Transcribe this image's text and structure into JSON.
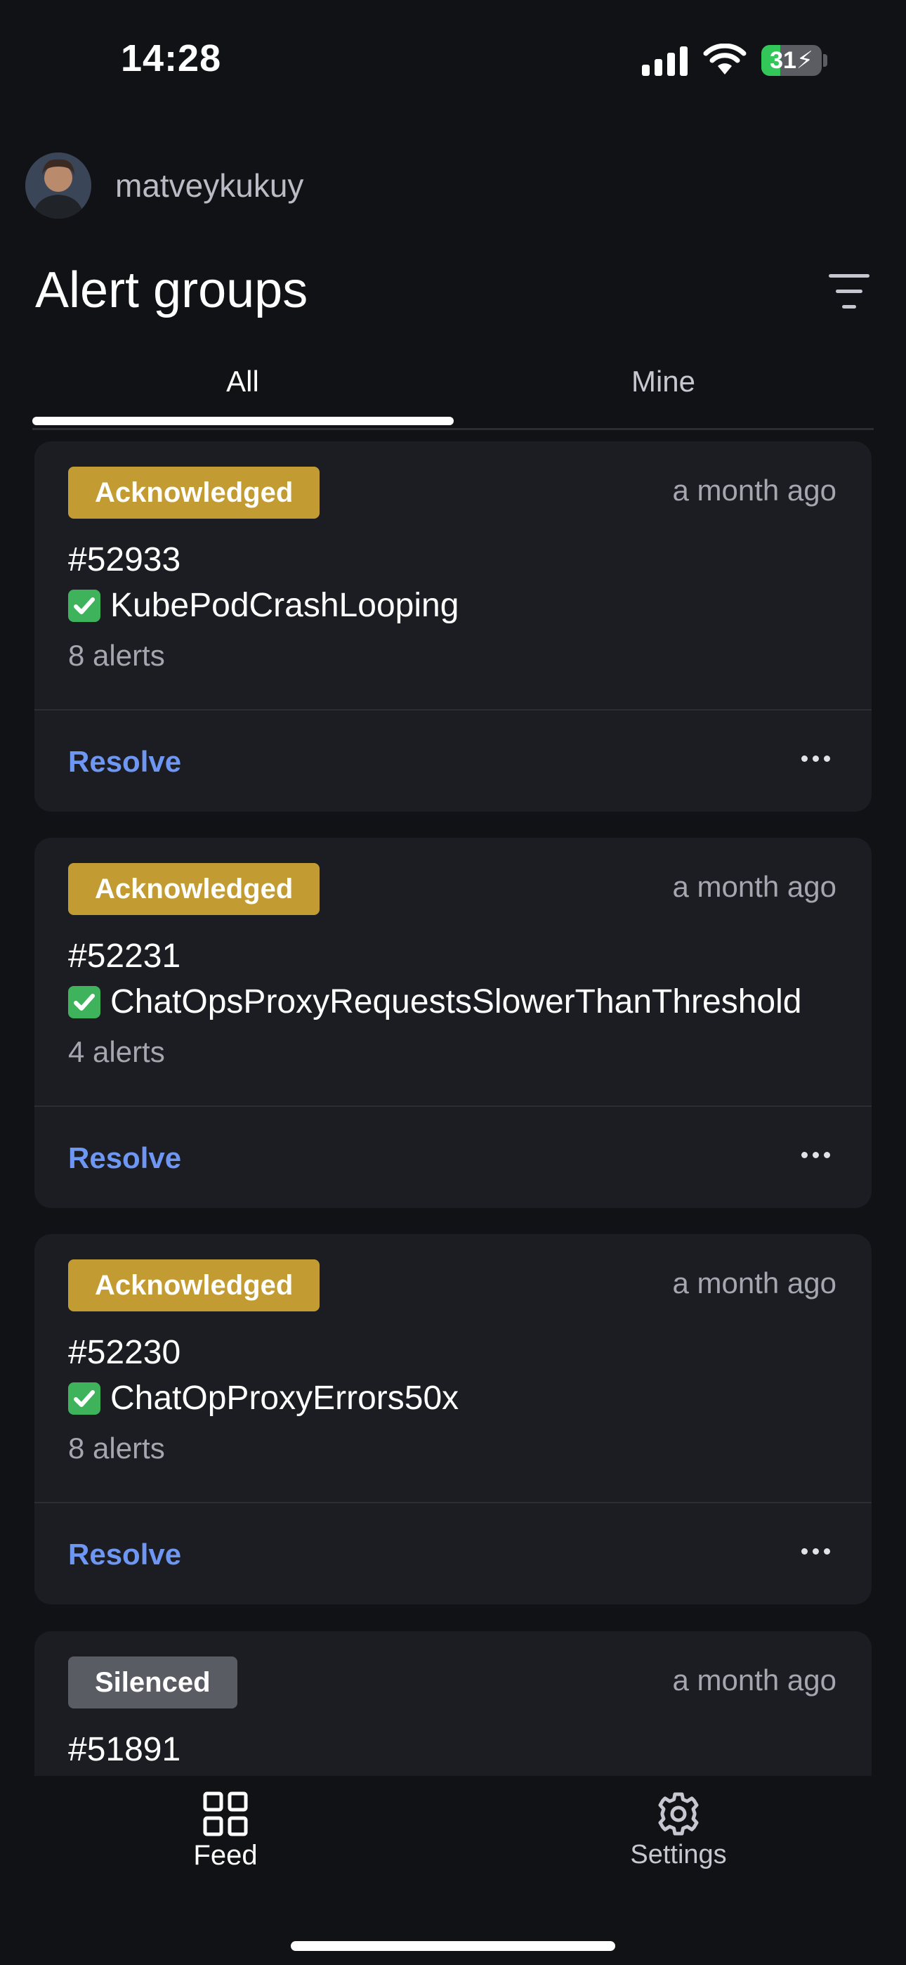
{
  "status_bar": {
    "time": "14:28",
    "battery_percent": "31",
    "battery_level": 0.31,
    "charging": true,
    "icons": [
      "cellular-signal-icon",
      "wifi-icon",
      "battery-charging-icon"
    ]
  },
  "user": {
    "username": "matveykukuy",
    "avatar": "avatar"
  },
  "header": {
    "title": "Alert groups",
    "filter_icon": "filter-icon"
  },
  "tabs": [
    {
      "label": "All",
      "selected": true
    },
    {
      "label": "Mine",
      "selected": false
    }
  ],
  "alert_groups": [
    {
      "status": "Acknowledged",
      "status_color": "#c29b32",
      "time": "a month ago",
      "id": "#52933",
      "name": "KubePodCrashLooping",
      "count": "8 alerts",
      "action": "Resolve",
      "status_icon": "check-mark-icon"
    },
    {
      "status": "Acknowledged",
      "status_color": "#c29b32",
      "time": "a month ago",
      "id": "#52231",
      "name": "ChatOpsProxyRequestsSlowerThanThreshold",
      "count": "4 alerts",
      "action": "Resolve",
      "status_icon": "check-mark-icon"
    },
    {
      "status": "Acknowledged",
      "status_color": "#c29b32",
      "time": "a month ago",
      "id": "#52230",
      "name": "ChatOpProxyErrors50x",
      "count": "8 alerts",
      "action": "Resolve",
      "status_icon": "check-mark-icon"
    },
    {
      "status": "Silenced",
      "status_color": "#5a5c63",
      "time": "a month ago",
      "id": "#51891"
    }
  ],
  "bottom_nav": {
    "feed": {
      "label": "Feed",
      "icon": "grid-icon"
    },
    "settings": {
      "label": "Settings",
      "icon": "gear-icon"
    }
  },
  "colors": {
    "background": "#111215",
    "card": "#1c1d22",
    "link": "#6e96f3",
    "muted_text": "#a4a7b0"
  }
}
